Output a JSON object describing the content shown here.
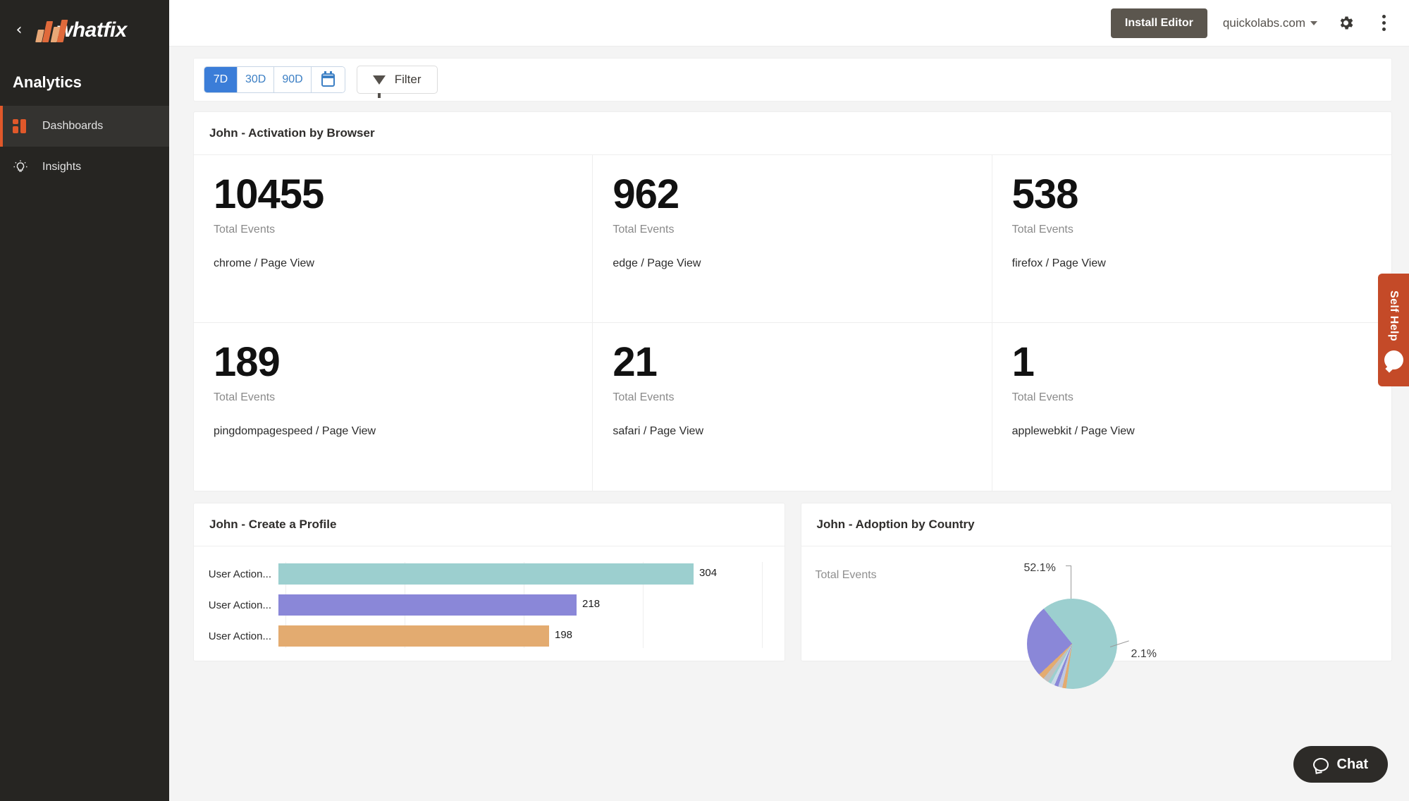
{
  "sidebar": {
    "back_icon": "chevron-left-icon",
    "brand": "whatfix",
    "section_title": "Analytics",
    "items": [
      {
        "label": "Dashboards",
        "icon": "dashboards-icon",
        "active": true
      },
      {
        "label": "Insights",
        "icon": "lightbulb-icon",
        "active": false
      }
    ]
  },
  "topbar": {
    "install_label": "Install Editor",
    "domain": "quickolabs.com",
    "gear_icon": "gear-icon",
    "kebab_icon": "more-vertical-icon"
  },
  "toolbar": {
    "ranges": [
      "7D",
      "30D",
      "90D"
    ],
    "selected_range": "7D",
    "calendar_icon": "calendar-icon",
    "filter_label": "Filter",
    "filter_icon": "funnel-icon"
  },
  "kpi_card": {
    "title": "John - Activation by Browser",
    "tiles": [
      {
        "value": "10455",
        "metric": "Total Events",
        "desc": "chrome / Page View"
      },
      {
        "value": "962",
        "metric": "Total Events",
        "desc": "edge / Page View"
      },
      {
        "value": "538",
        "metric": "Total Events",
        "desc": "firefox / Page View"
      },
      {
        "value": "189",
        "metric": "Total Events",
        "desc": "pingdompagespeed / Page View"
      },
      {
        "value": "21",
        "metric": "Total Events",
        "desc": "safari / Page View"
      },
      {
        "value": "1",
        "metric": "Total Events",
        "desc": "applewebkit / Page View"
      }
    ]
  },
  "bar_card": {
    "title": "John - Create a Profile"
  },
  "pie_card": {
    "title": "John - Adoption by Country",
    "metric_label": "Total Events"
  },
  "self_help": {
    "label": "Self Help",
    "icon": "question-bubble-icon"
  },
  "chat": {
    "label": "Chat",
    "icon": "chat-bubble-icon"
  },
  "colors": {
    "accent": "#e0582a",
    "primary_blue": "#3b7dd8",
    "sidebar_bg": "#262522",
    "teal": "#9ccfcf",
    "purple": "#8a87d8",
    "orange": "#e3ab70",
    "self_help": "#c44a28"
  },
  "chart_data": [
    {
      "type": "bar",
      "orientation": "horizontal",
      "title": "John - Create a Profile",
      "categories": [
        "User Action...",
        "User Action...",
        "User Action..."
      ],
      "values": [
        304,
        218,
        198
      ],
      "value_labels": [
        "304",
        "218",
        "198"
      ],
      "colors": [
        "#9ccfcf",
        "#8a87d8",
        "#e3ab70"
      ],
      "xlabel": "",
      "ylabel": "",
      "xlim": [
        0,
        360
      ],
      "grid": true,
      "legend": "none"
    },
    {
      "type": "pie",
      "title": "John - Adoption by Country",
      "metric_label": "Total Events",
      "labels": [
        "52.1%",
        "2.1%"
      ],
      "values": [
        52.1,
        26.0,
        5.0,
        4.0,
        3.5,
        3.0,
        2.1,
        2.0,
        1.5,
        0.8
      ],
      "annotations": [
        "52.1%",
        "2.1%"
      ],
      "colors": [
        "#9ccfcf",
        "#8a87d8",
        "#e3ab70",
        "#b0b0b0",
        "#c9d9e8",
        "#8a87d8",
        "#e3ab70",
        "#c0c0c0",
        "#9ccfcf",
        "#bfc7e0"
      ],
      "legend": "none"
    }
  ]
}
